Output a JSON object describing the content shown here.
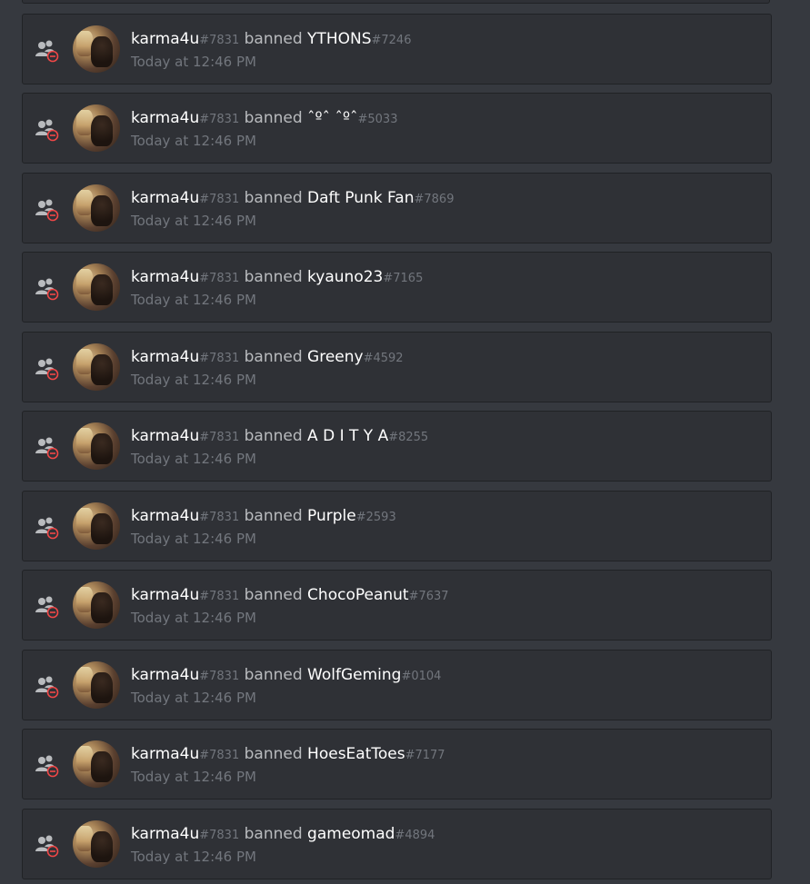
{
  "audit_log": {
    "action_label": "banned",
    "actor": {
      "name": "karma4u",
      "discriminator": "#7831"
    },
    "timestamp": "Today at 12:46 PM",
    "icon": "member-ban-icon",
    "colors": {
      "background": "#36393f",
      "entry_background": "#2f3136",
      "ban_badge": "#f04747",
      "icon_gray": "#b9bbbe"
    },
    "entries": [
      {
        "target": "YTHONS",
        "target_discriminator": "#7246"
      },
      {
        "target": "ˆºˆ ˆºˆ",
        "target_discriminator": "#5033"
      },
      {
        "target": "Daft Punk Fan",
        "target_discriminator": "#7869"
      },
      {
        "target": "kyauno23",
        "target_discriminator": "#7165"
      },
      {
        "target": "Greeny",
        "target_discriminator": "#4592"
      },
      {
        "target": "A D I T Y A",
        "target_discriminator": "#8255"
      },
      {
        "target": "Purple",
        "target_discriminator": "#2593"
      },
      {
        "target": "ChocoPeanut",
        "target_discriminator": "#7637"
      },
      {
        "target": "WolfGeming",
        "target_discriminator": "#0104"
      },
      {
        "target": "HoesEatToes",
        "target_discriminator": "#7177"
      },
      {
        "target": "gameomad",
        "target_discriminator": "#4894"
      }
    ]
  }
}
